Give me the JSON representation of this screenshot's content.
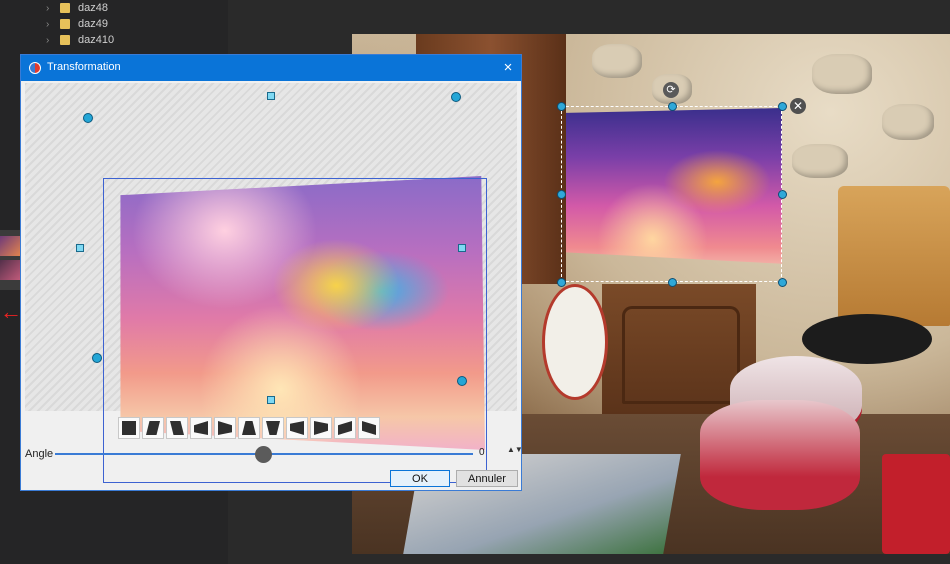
{
  "folders": [
    {
      "name": "daz48"
    },
    {
      "name": "daz49"
    },
    {
      "name": "daz410"
    }
  ],
  "dialog": {
    "title": "Transformation",
    "close_icon": "×",
    "presets": [
      "preset-rectangle",
      "preset-skew-right",
      "preset-skew-left",
      "preset-perspective-left-up",
      "preset-perspective-right-up",
      "preset-trapezoid-top",
      "preset-trapezoid-bottom",
      "preset-perspective-left-down",
      "preset-perspective-right-down",
      "preset-parallelogram-up",
      "preset-parallelogram-down"
    ],
    "angle_label": "Angle",
    "angle_value": "0",
    "angle_spin": "▲▼",
    "ok_label": "OK",
    "cancel_label": "Annuler"
  },
  "scene": {
    "close_icon": "✕",
    "rotate_icon": "⟳"
  },
  "colors": {
    "titlebar": "#0a74d8",
    "handle": "#24a6d6",
    "bbox": "#3d62d1"
  }
}
